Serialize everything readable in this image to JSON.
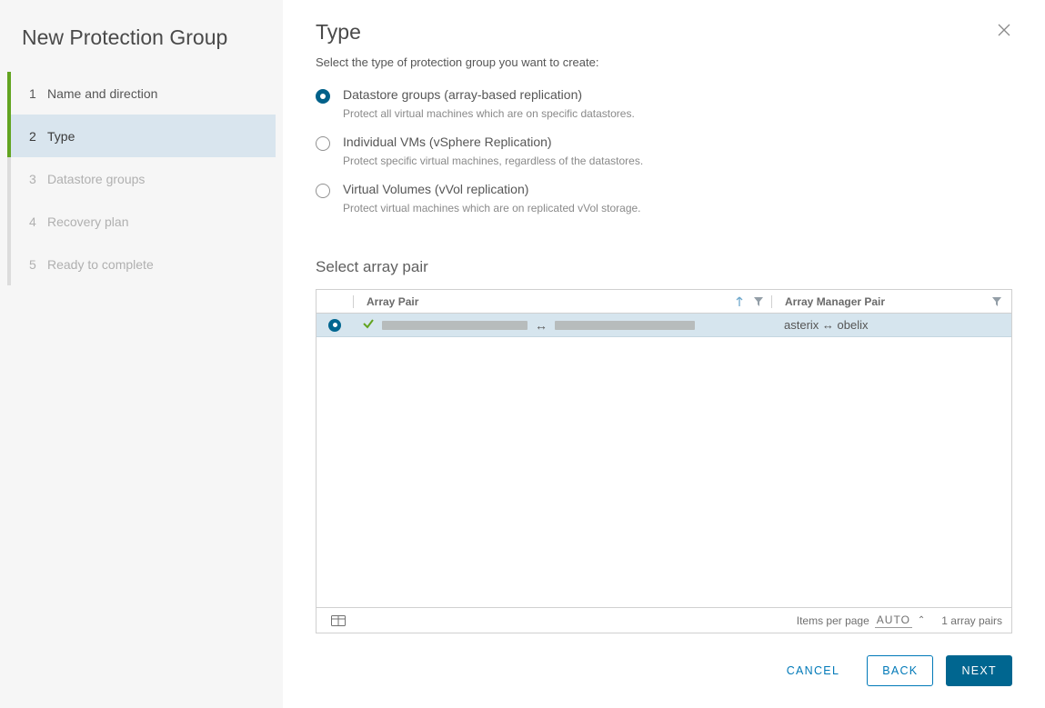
{
  "sidebar": {
    "title": "New Protection Group",
    "steps": [
      {
        "num": "1",
        "label": "Name and direction",
        "state": "done"
      },
      {
        "num": "2",
        "label": "Type",
        "state": "active"
      },
      {
        "num": "3",
        "label": "Datastore groups",
        "state": "pending"
      },
      {
        "num": "4",
        "label": "Recovery plan",
        "state": "pending"
      },
      {
        "num": "5",
        "label": "Ready to complete",
        "state": "pending"
      }
    ]
  },
  "header": {
    "title": "Type",
    "subtitle": "Select the type of protection group you want to create:"
  },
  "options": [
    {
      "label": "Datastore groups (array-based replication)",
      "hint": "Protect all virtual machines which are on specific datastores.",
      "selected": true
    },
    {
      "label": "Individual VMs (vSphere Replication)",
      "hint": "Protect specific virtual machines, regardless of the datastores.",
      "selected": false
    },
    {
      "label": "Virtual Volumes (vVol replication)",
      "hint": "Protect virtual machines which are on replicated vVol storage.",
      "selected": false
    }
  ],
  "arraypair": {
    "section_title": "Select array pair",
    "col_pair": "Array Pair",
    "col_mgr": "Array Manager Pair",
    "rows": [
      {
        "selected": true,
        "mgr": "asterix ↔ obelix"
      }
    ],
    "items_per_page_label": "Items per page",
    "items_per_page_value": "AUTO",
    "count_label": "1 array pairs"
  },
  "footer": {
    "cancel": "CANCEL",
    "back": "BACK",
    "next": "NEXT"
  }
}
